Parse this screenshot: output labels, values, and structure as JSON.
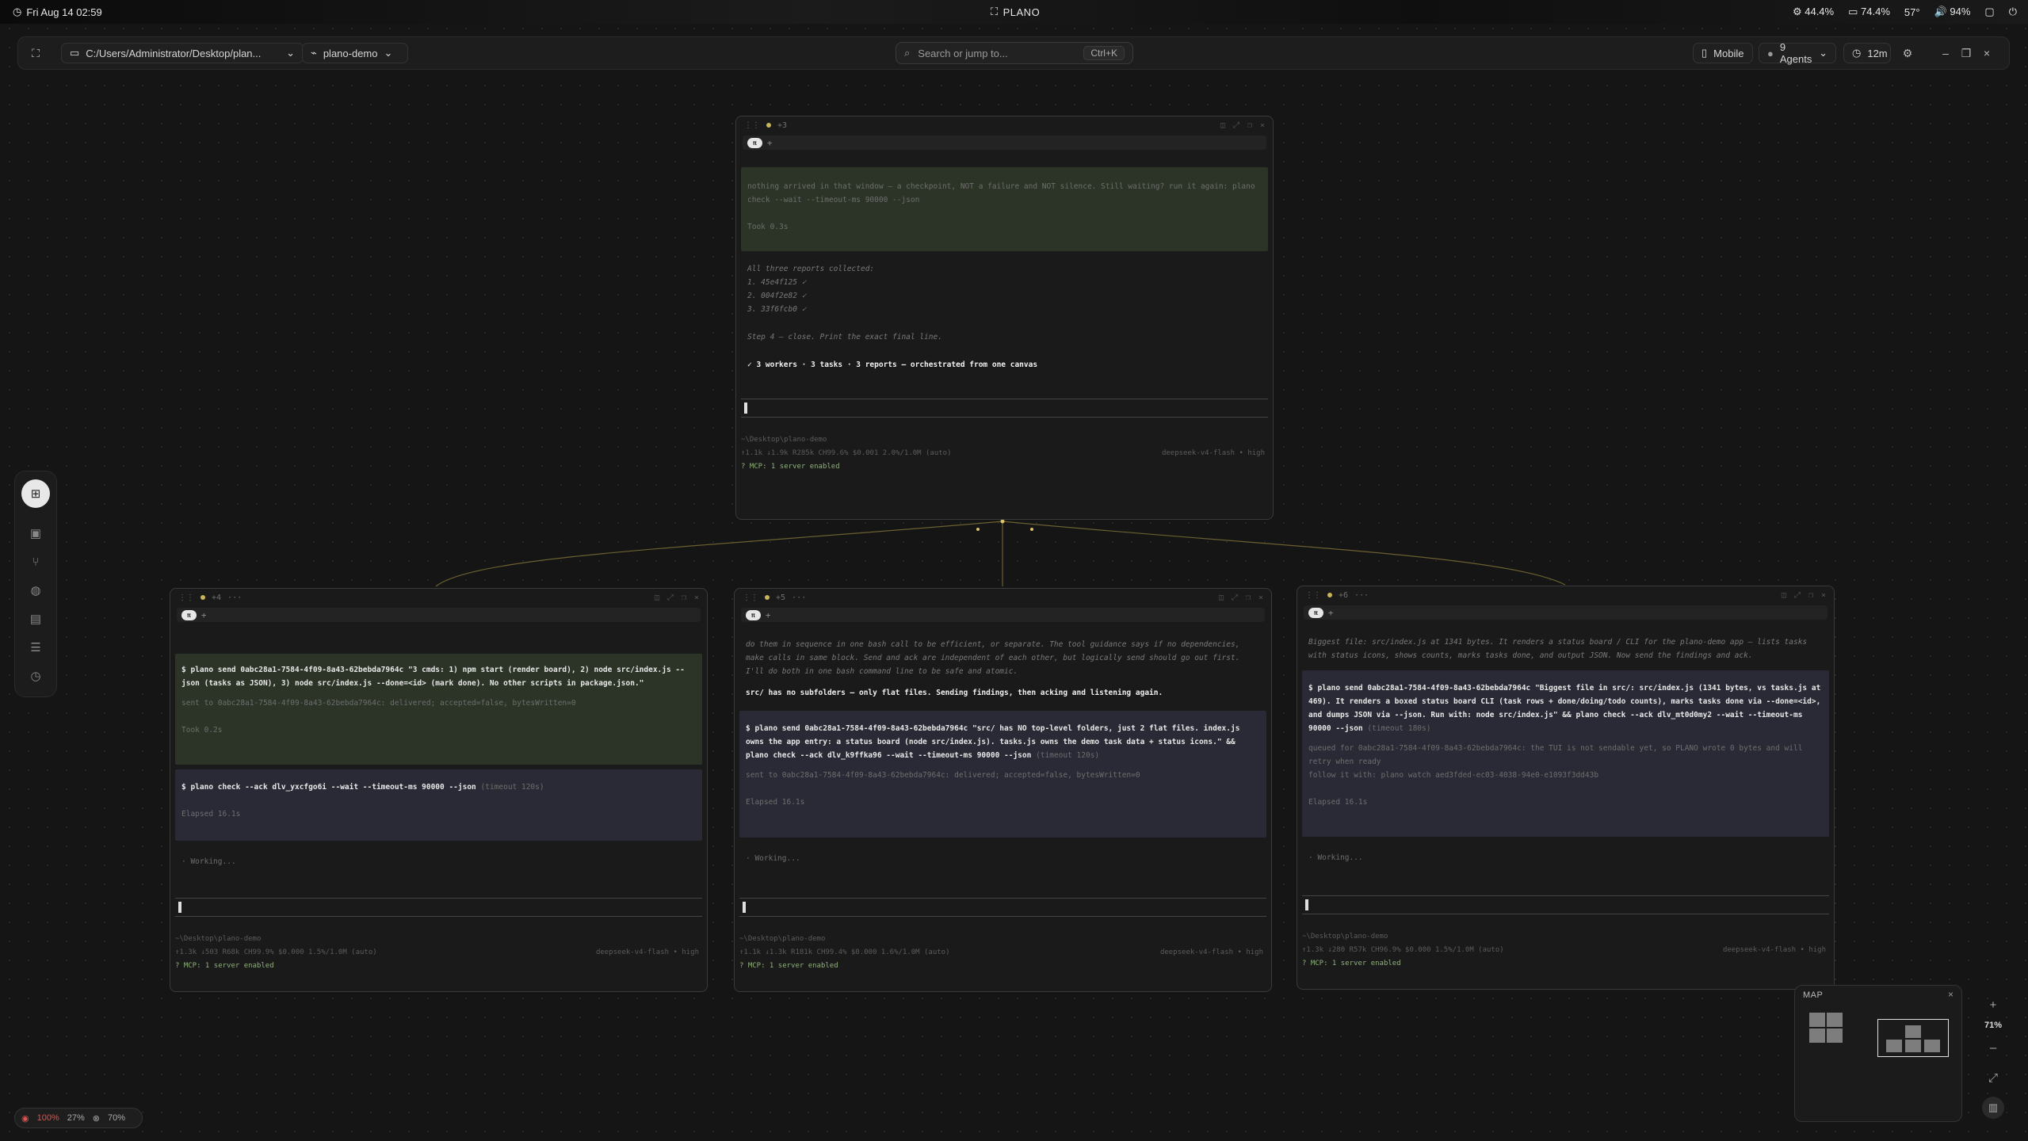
{
  "os": {
    "datetime": "Fri Aug 14 02:59",
    "app_name": "PLANO",
    "stats": [
      "44.4%",
      "74.4%",
      "57°",
      "94%"
    ]
  },
  "toolbar": {
    "path": "C:/Users/Administrator/Desktop/plan...",
    "project": "plano-demo",
    "search_placeholder": "Search or jump to...",
    "search_shortcut": "Ctrl+K",
    "mobile": "Mobile",
    "agents": "9 Agents",
    "timer": "12m"
  },
  "panels": {
    "top": {
      "tab": "π",
      "tab_badge": "+3",
      "text1": "nothing arrived in that window — a checkpoint, NOT a failure and NOT silence. Still waiting? run it again: plano check --wait --timeout-ms 90000 --json",
      "took": "Took 0.3s",
      "collected": "All three reports collected:",
      "reports": [
        "1. 45e4f125 ✓",
        "2. 004f2e82 ✓",
        "3. 33f6fcb0 ✓"
      ],
      "step": "Step 4 — close. Print the exact final line.",
      "final": "✓ 3 workers · 3 tasks · 3 reports — orchestrated from one canvas",
      "path": "~\\Desktop\\plano-demo",
      "stats": "↑1.1k ↓1.9k R285k CH99.6% $0.001 2.0%/1.0M (auto)",
      "model": "deepseek-v4-flash • high",
      "mcp": "MCP: 1 server enabled"
    },
    "left": {
      "tab": "π",
      "tab_badge": "+4",
      "cmd1": "$ plano send 0abc28a1-7584-4f09-8a43-62bebda7964c \"3 cmds: 1) npm start (render board), 2) node src/index.js --json (tasks as JSON), 3) node src/index.js --done=<id> (mark done). No other scripts in package.json.\"",
      "sent1": "sent to 0abc28a1-7584-4f09-8a43-62bebda7964c: delivered; accepted=false, bytesWritten=0",
      "took1": "Took 0.2s",
      "cmd2": "$ plano check --ack dlv_yxcfgo6i --wait --timeout-ms 90000 --json",
      "cmd2_timeout": "(timeout 120s)",
      "elapsed": "Elapsed 16.1s",
      "working": "· Working...",
      "path": "~\\Desktop\\plano-demo",
      "stats": "↑1.3k ↓503 R68k CH99.9% $0.000 1.5%/1.0M (auto)",
      "model": "deepseek-v4-flash • high",
      "mcp": "MCP: 1 server enabled"
    },
    "middle": {
      "tab": "π",
      "tab_badge": "+5",
      "text1": "do them in sequence in one bash call to be efficient, or separate. The tool guidance says if no dependencies, make calls in same block. Send and ack are independent of each other, but logically send should go out first. I'll do both in one bash command line to be safe and atomic.",
      "text2": "src/ has no subfolders — only flat files. Sending findings, then acking and listening again.",
      "cmd1": "$ plano send 0abc28a1-7584-4f09-8a43-62bebda7964c \"src/ has NO top-level folders, just 2 flat files. index.js owns the app entry: a status board (node src/index.js). tasks.js owns the demo task data + status icons.\" && plano check --ack dlv_k9ffka96 --wait --timeout-ms 90000 --json",
      "cmd1_timeout": "(timeout 120s)",
      "sent1": "sent to 0abc28a1-7584-4f09-8a43-62bebda7964c: delivered; accepted=false, bytesWritten=0",
      "elapsed": "Elapsed 16.1s",
      "working": "· Working...",
      "path": "~\\Desktop\\plano-demo",
      "stats": "↑1.1k ↓1.3k R181k CH99.4% $0.000 1.6%/1.0M (auto)",
      "model": "deepseek-v4-flash • high",
      "mcp": "MCP: 1 server enabled"
    },
    "right": {
      "tab": "π",
      "tab_badge": "+6",
      "text1": "Biggest file: src/index.js at 1341 bytes. It renders a status board / CLI for the plano-demo app — lists tasks with status icons, shows counts, marks tasks done, and output JSON. Now send the findings and ack.",
      "cmd1": "$ plano send 0abc28a1-7584-4f09-8a43-62bebda7964c \"Biggest file in src/: src/index.js (1341 bytes, vs tasks.js at 469). It renders a boxed status board CLI (task rows + done/doing/todo counts), marks tasks done via --done=<id>, and dumps JSON via --json. Run with: node src/index.js\" && plano check --ack dlv_mt0d0my2 --wait --timeout-ms 90000 --json",
      "cmd1_timeout": "(timeout 180s)",
      "queued": "queued for 0abc28a1-7584-4f09-8a43-62bebda7964c: the TUI is not sendable yet, so PLANO wrote 0 bytes and will retry when ready",
      "follow": "follow it with: plano watch aed3fded-ec03-4038-94e0-e1093f3dd43b",
      "elapsed": "Elapsed 16.1s",
      "working": "· Working...",
      "path": "~\\Desktop\\plano-demo",
      "stats": "↑1.3k ↓280 R57k CH96.9% $0.000 1.5%/1.0M (auto)",
      "model": "deepseek-v4-flash • high",
      "mcp": "MCP: 1 server enabled"
    }
  },
  "minimap": {
    "label": "MAP",
    "zoom": "71%"
  },
  "status": {
    "a": "100%",
    "b": "27%",
    "c": "70%"
  },
  "colors": {
    "accent_line": "#8a7a3f",
    "terminal_green": "#2b3427",
    "terminal_blue": "#2a2a36"
  }
}
